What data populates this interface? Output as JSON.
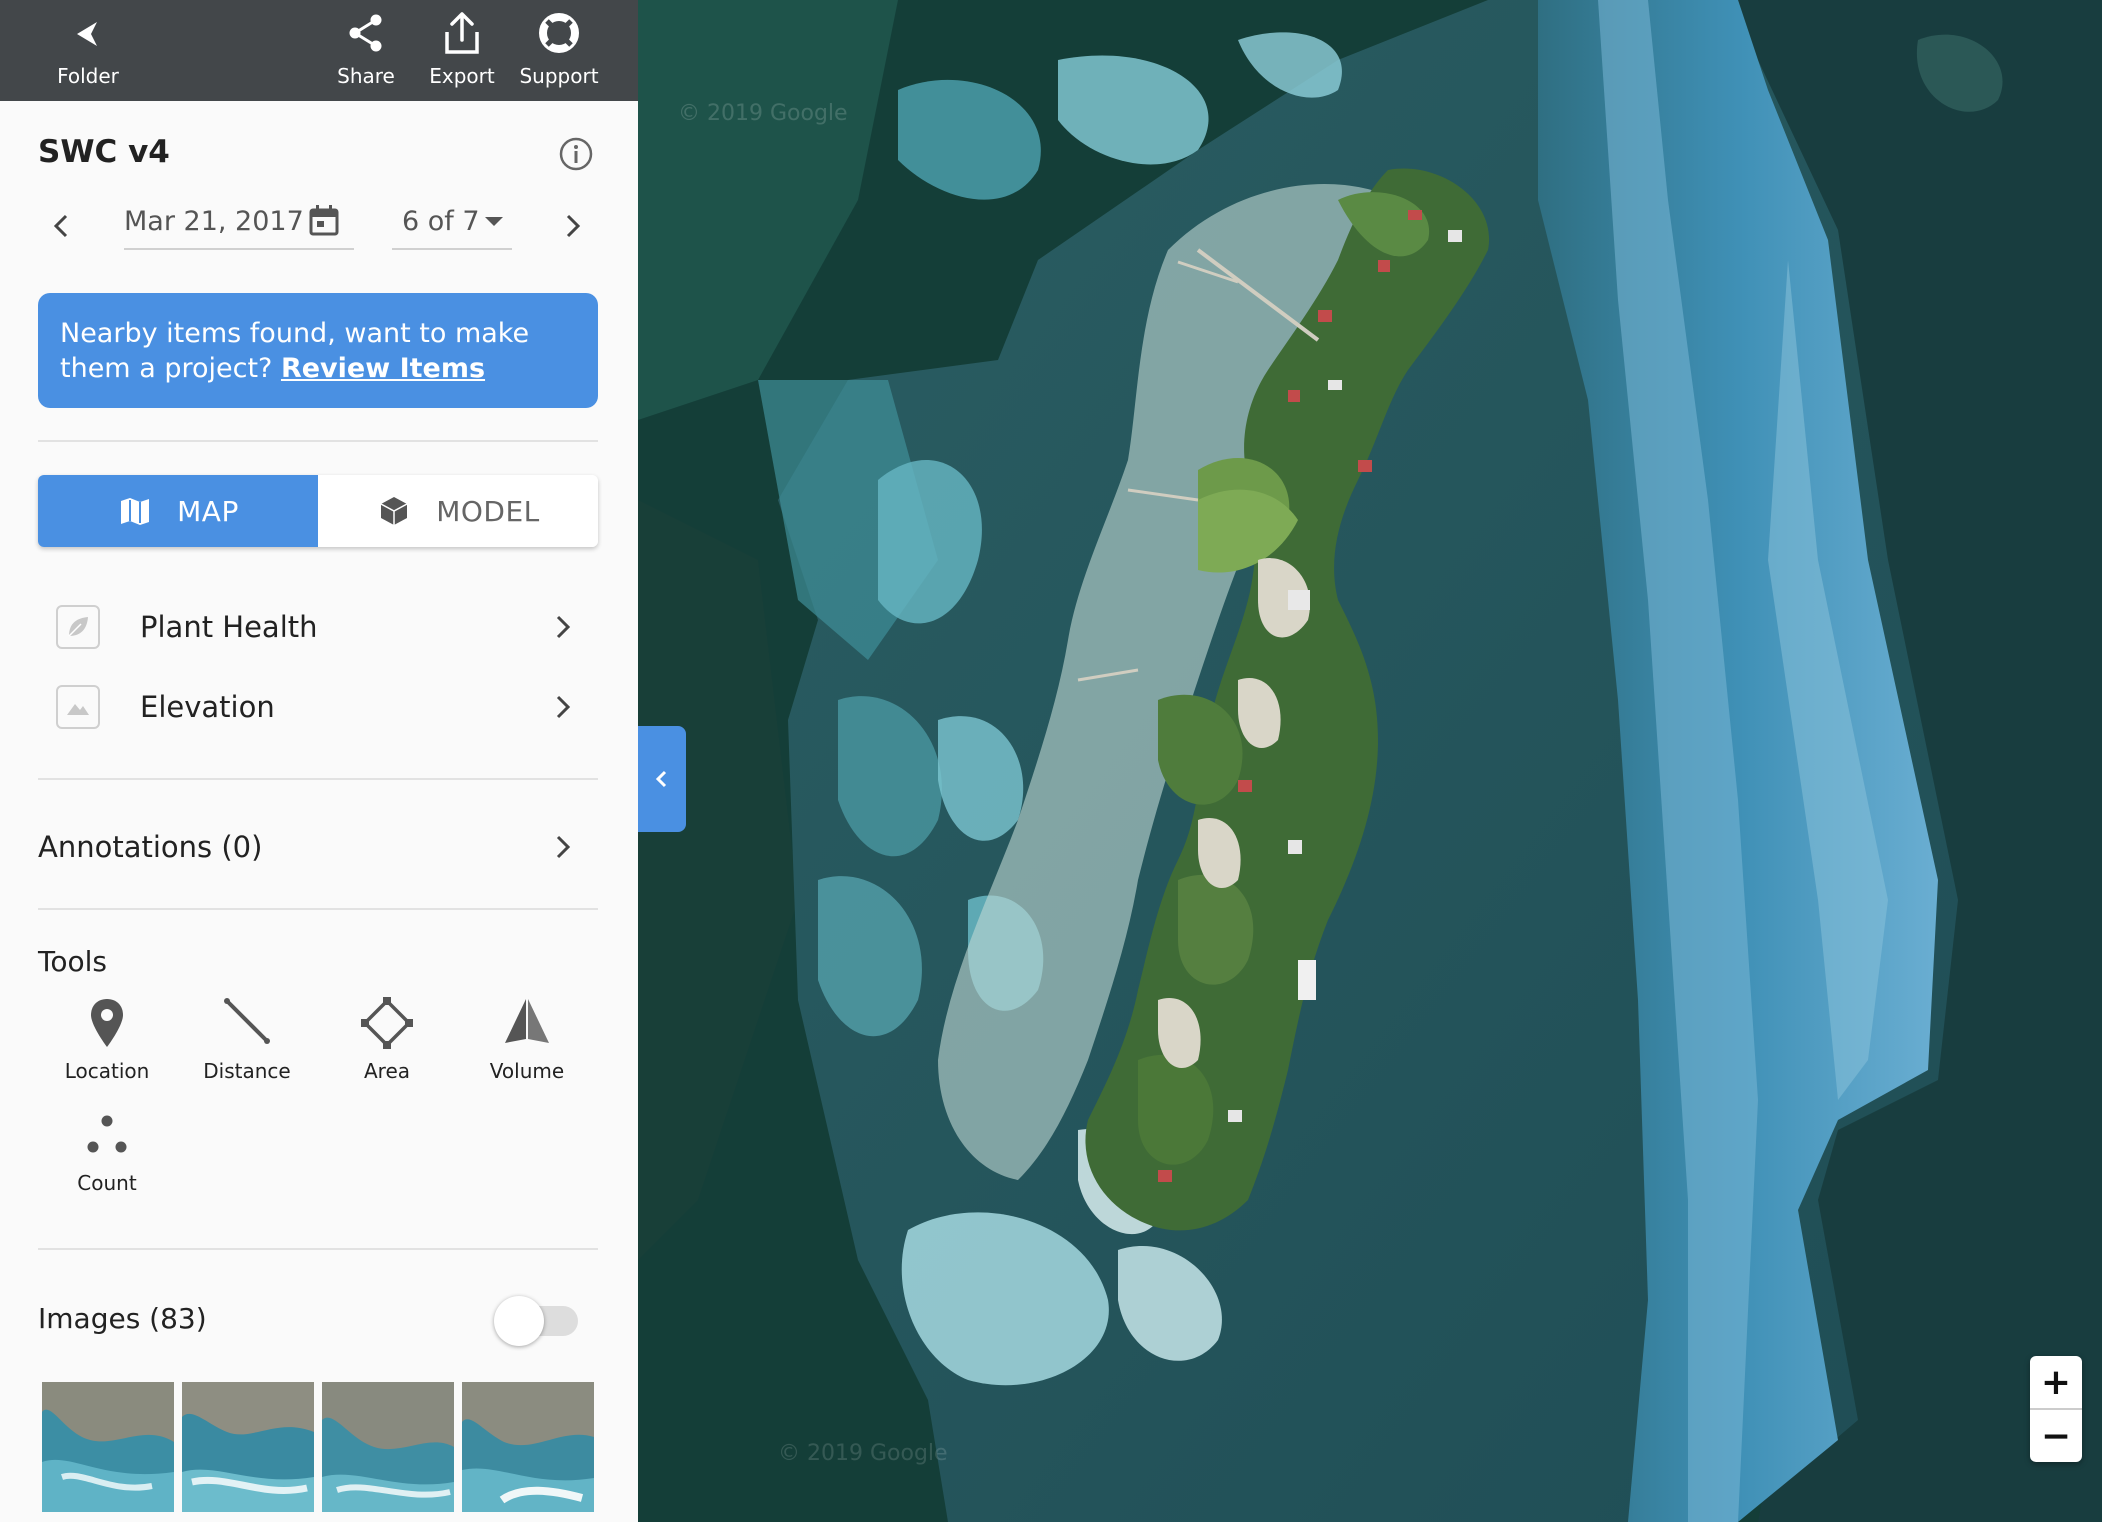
{
  "topbar": {
    "folder_label": "Folder",
    "share_label": "Share",
    "export_label": "Export",
    "support_label": "Support"
  },
  "project": {
    "title": "SWC v4"
  },
  "date_nav": {
    "date": "Mar 21, 2017",
    "position": "6 of 7"
  },
  "banner": {
    "text": "Nearby items found, want to make them a project?",
    "link": "Review Items"
  },
  "view_toggle": {
    "map_label": "MAP",
    "model_label": "MODEL",
    "active": "MAP"
  },
  "layers": [
    {
      "label": "Plant Health",
      "icon": "leaf-icon"
    },
    {
      "label": "Elevation",
      "icon": "mountain-icon"
    }
  ],
  "annotations": {
    "label": "Annotations (0)"
  },
  "tools": {
    "title": "Tools",
    "items": [
      {
        "label": "Location",
        "icon": "location-pin-icon"
      },
      {
        "label": "Distance",
        "icon": "distance-icon"
      },
      {
        "label": "Area",
        "icon": "area-icon"
      },
      {
        "label": "Volume",
        "icon": "volume-icon"
      },
      {
        "label": "Count",
        "icon": "count-icon"
      }
    ]
  },
  "images": {
    "label": "Images (83)",
    "toggle_on": false,
    "thumbnail_count": 4
  },
  "map": {
    "zoom_in": "+",
    "zoom_out": "−",
    "watermark": "© 2019 Google"
  },
  "colors": {
    "accent": "#4a90e2",
    "topbar": "#43474a",
    "sidebar_bg": "#fafafa"
  }
}
